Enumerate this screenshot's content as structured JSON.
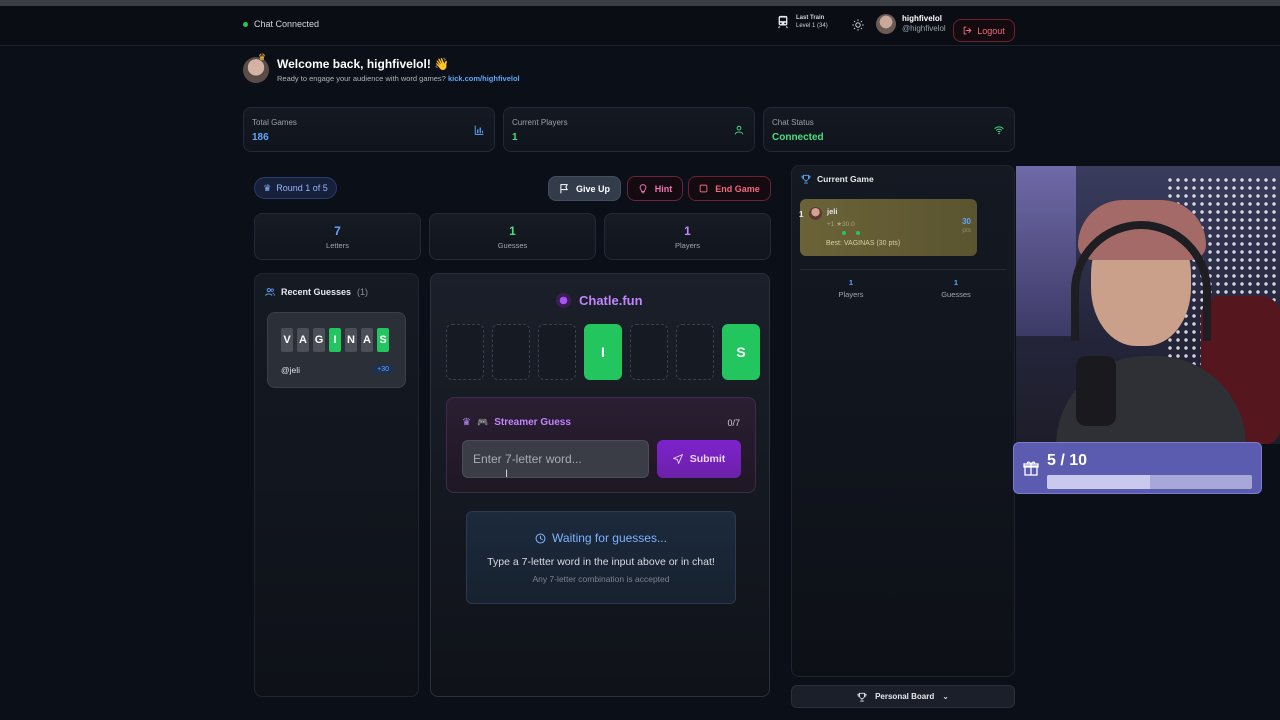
{
  "topbar": {
    "connection_status": "Chat Connected",
    "train_title": "Last Train",
    "train_level": "Level 1",
    "train_count": "(34)",
    "user_name": "highfivelol",
    "user_handle": "@highfivelol",
    "logout_label": "Logout"
  },
  "welcome": {
    "title": "Welcome back, highfivelol! 👋",
    "subtitle": "Ready to engage your audience with word games?",
    "link": "kick.com/highfivelol"
  },
  "stats": [
    {
      "label": "Total Games",
      "value": "186",
      "color": "#60a5fa",
      "icon": "bar-chart-icon"
    },
    {
      "label": "Current Players",
      "value": "1",
      "color": "#4ade80",
      "icon": "user-icon"
    },
    {
      "label": "Chat Status",
      "value": "Connected",
      "color": "#4ade80",
      "icon": "wifi-icon"
    }
  ],
  "controls": {
    "round_label": "Round 1 of 5",
    "give_up_label": "Give Up",
    "hint_label": "Hint",
    "end_game_label": "End Game"
  },
  "mini_stats": [
    {
      "value": "7",
      "label": "Letters",
      "color": "#60a5fa"
    },
    {
      "value": "1",
      "label": "Guesses",
      "color": "#4ade80"
    },
    {
      "value": "1",
      "label": "Players",
      "color": "#c084fc"
    }
  ],
  "recent": {
    "title": "Recent Guesses",
    "count": "(1)",
    "guesses": [
      {
        "letters": [
          {
            "ch": "V",
            "state": "absent"
          },
          {
            "ch": "A",
            "state": "absent"
          },
          {
            "ch": "G",
            "state": "absent"
          },
          {
            "ch": "I",
            "state": "correct"
          },
          {
            "ch": "N",
            "state": "absent"
          },
          {
            "ch": "A",
            "state": "absent"
          },
          {
            "ch": "S",
            "state": "correct"
          }
        ],
        "user": "@jeli",
        "points": "+30"
      }
    ]
  },
  "board": {
    "brand": "Chatle.fun",
    "slots": [
      "",
      "",
      "",
      "I",
      "",
      "",
      "S"
    ],
    "streamer_title": "Streamer Guess",
    "streamer_count": "0/7",
    "input_placeholder": "Enter 7-letter word...",
    "submit_label": "Submit",
    "waiting_title": "Waiting for guesses...",
    "waiting_sub": "Type a 7-letter word in the input above or in chat!",
    "waiting_note": "Any 7-letter combination is accepted"
  },
  "current_game": {
    "title": "Current Game",
    "players": [
      {
        "rank": "1",
        "name": "jeli",
        "stats": "+1 ★30.0",
        "best": "Best: VAGINAS (30 pts)",
        "points": "30",
        "points_unit": "pts"
      }
    ],
    "players_value": "1",
    "players_label": "Players",
    "guesses_value": "1",
    "guesses_label": "Guesses"
  },
  "personal_board_label": "Personal Board",
  "goal": {
    "text": "5 / 10",
    "progress": 0.5
  }
}
